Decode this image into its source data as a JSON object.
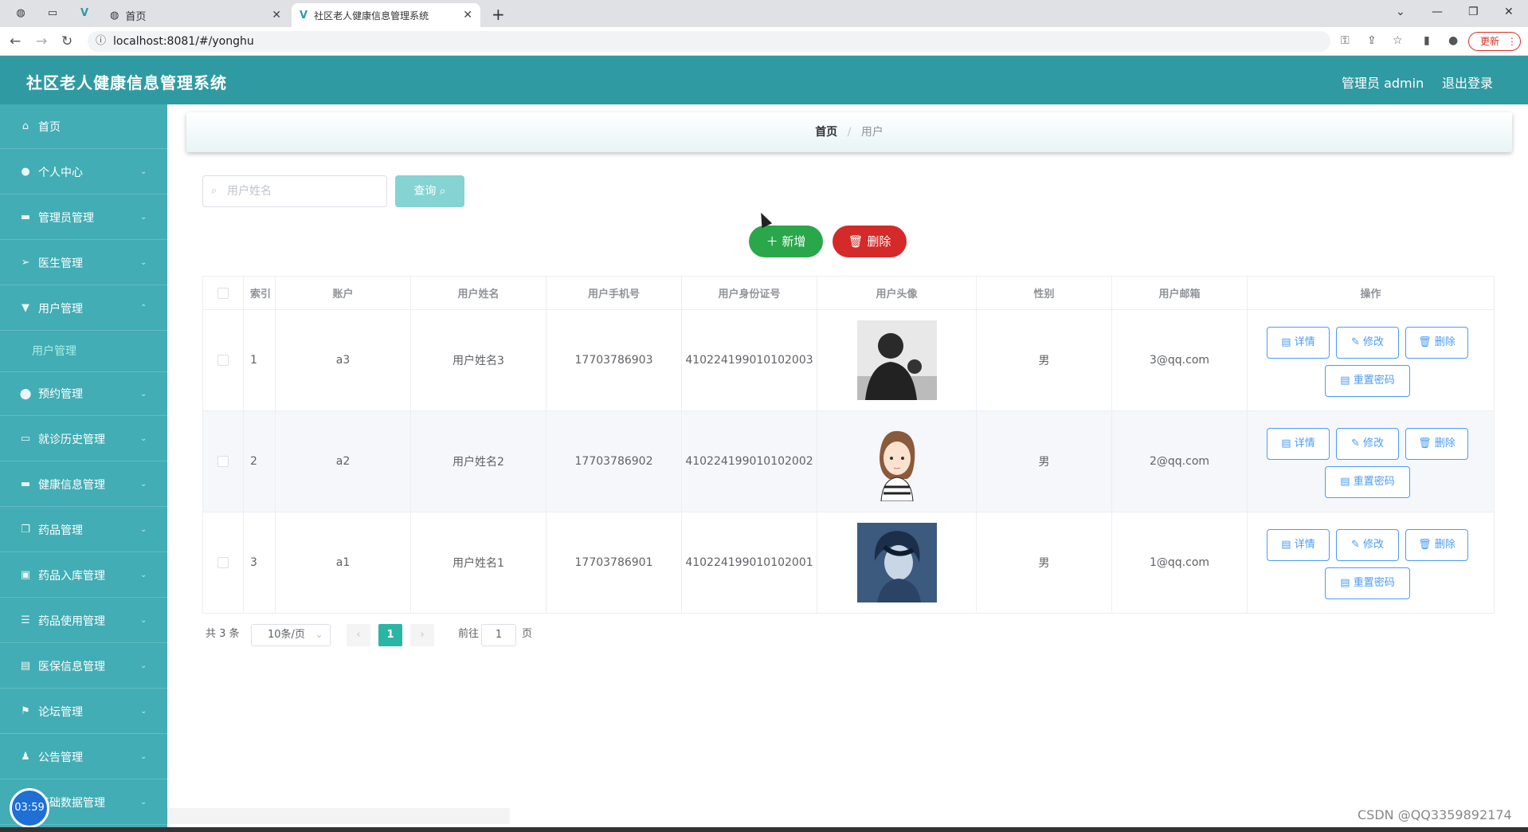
{
  "browser": {
    "tabs": [
      {
        "label": "首页"
      },
      {
        "label": "社区老人健康信息管理系统"
      }
    ],
    "url": "localhost:8081/#/yonghu",
    "update_label": "更新"
  },
  "header": {
    "title": "社区老人健康信息管理系统",
    "user": "管理员 admin",
    "logout": "退出登录"
  },
  "sidebar": {
    "items": [
      {
        "label": "首页"
      },
      {
        "label": "个人中心"
      },
      {
        "label": "管理员管理"
      },
      {
        "label": "医生管理"
      },
      {
        "label": "用户管理"
      },
      {
        "label": "预约管理"
      },
      {
        "label": "就诊历史管理"
      },
      {
        "label": "健康信息管理"
      },
      {
        "label": "药品管理"
      },
      {
        "label": "药品入库管理"
      },
      {
        "label": "药品使用管理"
      },
      {
        "label": "医保信息管理"
      },
      {
        "label": "论坛管理"
      },
      {
        "label": "公告管理"
      },
      {
        "label": "基础数据管理"
      }
    ],
    "submenu_active": "用户管理",
    "timer": "03:59"
  },
  "breadcrumb": {
    "home": "首页",
    "sep": "/",
    "current": "用户"
  },
  "search": {
    "placeholder": "用户姓名",
    "query_label": "查询"
  },
  "actions": {
    "add_label": "新增",
    "delete_label": "删除"
  },
  "table": {
    "headers": [
      "索引",
      "账户",
      "用户姓名",
      "用户手机号",
      "用户身份证号",
      "用户头像",
      "性别",
      "用户邮箱",
      "操作"
    ],
    "rows": [
      {
        "index": "1",
        "account": "a3",
        "name": "用户姓名3",
        "phone": "17703786903",
        "idcard": "410224199010102003",
        "gender": "男",
        "email": "3@qq.com"
      },
      {
        "index": "2",
        "account": "a2",
        "name": "用户姓名2",
        "phone": "17703786902",
        "idcard": "410224199010102002",
        "gender": "男",
        "email": "2@qq.com"
      },
      {
        "index": "3",
        "account": "a1",
        "name": "用户姓名1",
        "phone": "17703786901",
        "idcard": "410224199010102001",
        "gender": "男",
        "email": "1@qq.com"
      }
    ],
    "op_labels": {
      "detail": "详情",
      "edit": "修改",
      "delete": "删除",
      "reset": "重置密码"
    }
  },
  "pagination": {
    "total": "共 3 条",
    "page_size": "10条/页",
    "current_page": "1",
    "goto_label": "前往",
    "goto_value": "1",
    "page_suffix": "页"
  },
  "watermark": "CSDN @QQ3359892174",
  "colors": {
    "header": "#2f9aa1",
    "sidebar": "#42adb4",
    "add": "#2aa74b",
    "delete": "#d42a2a",
    "op_border": "#4b9cf5"
  }
}
